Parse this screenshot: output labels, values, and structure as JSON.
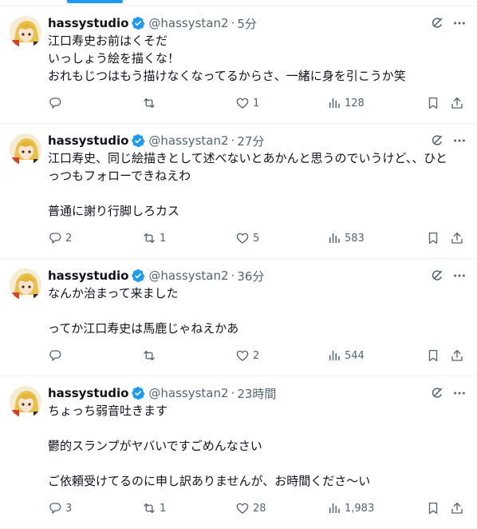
{
  "tweets": [
    {
      "display_name": "hassystudio",
      "handle": "@hassystan2",
      "time": "5分",
      "lines": [
        "江口寿史お前はくそだ",
        "いっしょう絵を描くな！",
        "おれもじつはもう描けなくなってるからさ、一緒に身を引こうか笑"
      ],
      "replies": "",
      "retweets": "",
      "likes": "1",
      "views": "128"
    },
    {
      "display_name": "hassystudio",
      "handle": "@hassystan2",
      "time": "27分",
      "lines": [
        "江口寿史、同じ絵描きとして述べないとあかんと思うのでいうけど、、ひと",
        "っつもフォローできねえわ",
        "",
        "普通に謝り行脚しろカス"
      ],
      "replies": "2",
      "retweets": "1",
      "likes": "5",
      "views": "583"
    },
    {
      "display_name": "hassystudio",
      "handle": "@hassystan2",
      "time": "36分",
      "lines": [
        "なんか治まって来ました",
        "",
        "ってか江口寿史は馬鹿じゃねえかあ"
      ],
      "replies": "",
      "retweets": "",
      "likes": "2",
      "views": "544"
    },
    {
      "display_name": "hassystudio",
      "handle": "@hassystan2",
      "time": "23時間",
      "lines": [
        "ちょっち弱音吐きます",
        "",
        "鬱的スランプがヤバいですごめんなさい",
        "",
        "ご依頼受けてるのに申し訳ありませんが、お時間くださ〜い"
      ],
      "replies": "3",
      "retweets": "1",
      "likes": "28",
      "views": "1,983"
    }
  ],
  "dot": "·",
  "icons": {
    "verified": "verified-badge-icon",
    "grok": "grok-icon",
    "more": "more-icon",
    "reply": "reply-icon",
    "retweet": "retweet-icon",
    "like": "heart-icon",
    "views": "views-icon",
    "bookmark": "bookmark-icon",
    "share": "share-icon"
  },
  "colors": {
    "accent": "#1d9bf0",
    "text": "#0f1419",
    "muted": "#536471",
    "divider": "#eff3f4"
  }
}
